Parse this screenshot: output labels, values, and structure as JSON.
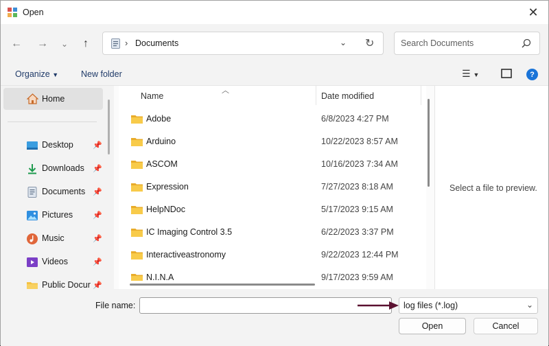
{
  "window": {
    "title": "Open"
  },
  "address": {
    "crumb": "Documents"
  },
  "search": {
    "placeholder": "Search Documents"
  },
  "toolbar": {
    "organize": "Organize",
    "new_folder": "New folder"
  },
  "navpane": {
    "home": "Home",
    "items": [
      {
        "label": "Desktop",
        "icon": "desktop-icon"
      },
      {
        "label": "Downloads",
        "icon": "download-icon"
      },
      {
        "label": "Documents",
        "icon": "document-icon"
      },
      {
        "label": "Pictures",
        "icon": "pictures-icon"
      },
      {
        "label": "Music",
        "icon": "music-icon"
      },
      {
        "label": "Videos",
        "icon": "videos-icon"
      },
      {
        "label": "Public Docur",
        "icon": "folder-icon"
      }
    ]
  },
  "filelist": {
    "col_name": "Name",
    "col_date": "Date modified",
    "rows": [
      {
        "name": "Adobe",
        "date": "6/8/2023 4:27 PM"
      },
      {
        "name": "Arduino",
        "date": "10/22/2023 8:57 AM"
      },
      {
        "name": "ASCOM",
        "date": "10/16/2023 7:34 AM"
      },
      {
        "name": "Expression",
        "date": "7/27/2023 8:18 AM"
      },
      {
        "name": "HelpNDoc",
        "date": "5/17/2023 9:15 AM"
      },
      {
        "name": "IC Imaging Control 3.5",
        "date": "6/22/2023 3:37 PM"
      },
      {
        "name": "Interactiveastronomy",
        "date": "9/22/2023 12:44 PM"
      },
      {
        "name": "N.I.N.A",
        "date": "9/17/2023 9:59 AM"
      }
    ]
  },
  "preview": {
    "message": "Select a file to preview."
  },
  "bottom": {
    "filename_label": "File name:",
    "filename_value": "",
    "filter": "log files (*.log)",
    "open": "Open",
    "cancel": "Cancel"
  },
  "colors": {
    "accent": "#1a74d8",
    "folder": "#f5c242",
    "annotation_arrow": "#5a1030"
  }
}
